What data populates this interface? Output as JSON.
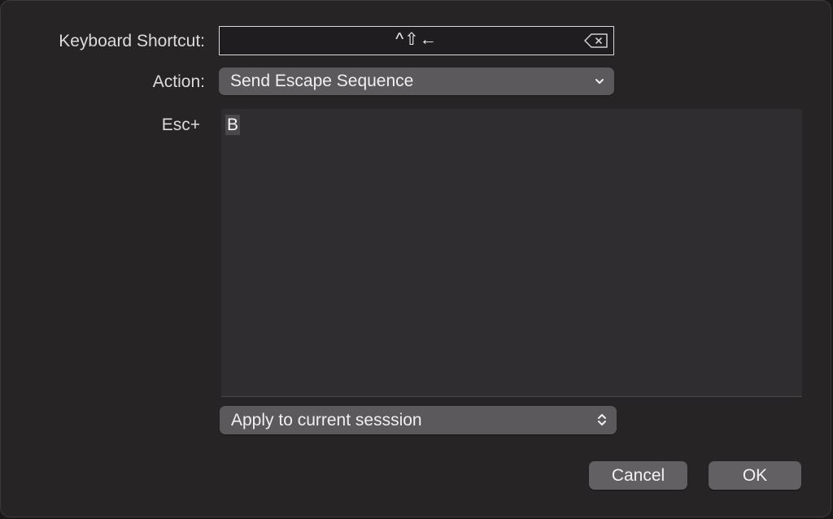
{
  "dialog": {
    "shortcut": {
      "label": "Keyboard Shortcut:",
      "keys": "^⇧←",
      "clear_icon": "clear-backspace-icon"
    },
    "action": {
      "label": "Action:",
      "selected": "Send Escape Sequence",
      "icon": "chevron-down-icon"
    },
    "escape": {
      "label": "Esc+",
      "value": "B"
    },
    "scope": {
      "selected": "Apply to current sesssion",
      "icon": "up-down-chevron-icon"
    },
    "buttons": {
      "cancel": "Cancel",
      "ok": "OK"
    }
  },
  "colors": {
    "background": "#272426",
    "control": "#5b595b",
    "text_area": "#302d30",
    "text": "#f0f0f0"
  }
}
